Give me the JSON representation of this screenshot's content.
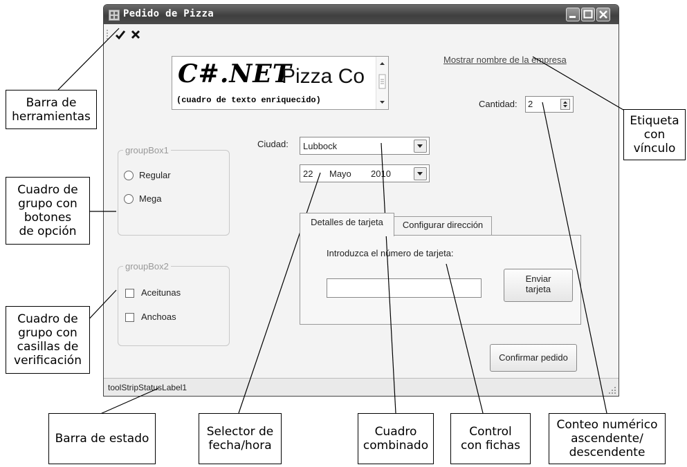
{
  "window": {
    "title": "Pedido de Pizza",
    "title_buttons": {
      "minimize": "minimize-icon",
      "maximize": "maximize-icon",
      "close": "close-icon"
    }
  },
  "toolbar": {
    "items": [
      {
        "icon": "checkmark-icon"
      },
      {
        "icon": "cross-icon"
      }
    ]
  },
  "rich_text": {
    "line1": "C#.NET",
    "line1_suffix": "Pizza Co",
    "line2": "(cuadro de texto enriquecido)"
  },
  "link_label": "Mostrar nombre de la empresa",
  "quantity": {
    "label": "Cantidad:",
    "value": "2"
  },
  "city": {
    "label": "Ciudad:",
    "value": "Lubbock"
  },
  "date": {
    "day": "22",
    "month": "Mayo",
    "year": "2010"
  },
  "group1": {
    "title": "groupBox1",
    "options": [
      "Regular",
      "Mega"
    ]
  },
  "group2": {
    "title": "groupBox2",
    "options": [
      "Aceitunas",
      "Anchoas"
    ]
  },
  "tabs": {
    "items": [
      "Detalles de tarjeta",
      "Configurar dirección"
    ],
    "active": "Detalles de tarjeta",
    "card_prompt": "Introduzca el número de tarjeta:",
    "card_value": "",
    "send_button": [
      "Enviar",
      "tarjeta"
    ]
  },
  "confirm_button": "Confirmar pedido",
  "status_label": "toolStripStatusLabel1",
  "callouts": {
    "toolbar": [
      "Barra de",
      "herramientas"
    ],
    "radio_group": [
      "Cuadro de",
      "grupo con",
      "botones",
      "de opción"
    ],
    "check_group": [
      "Cuadro de",
      "grupo con",
      "casillas de",
      "verificación"
    ],
    "link_label": [
      "Etiqueta",
      "con",
      "vínculo"
    ],
    "status_bar": "Barra de estado",
    "date_picker": [
      "Selector de",
      "fecha/hora"
    ],
    "combo": [
      "Cuadro",
      "combinado"
    ],
    "tab_control": [
      "Control",
      "con fichas"
    ],
    "numeric": [
      "Conteo numérico",
      "ascendente/",
      "descendente"
    ]
  }
}
